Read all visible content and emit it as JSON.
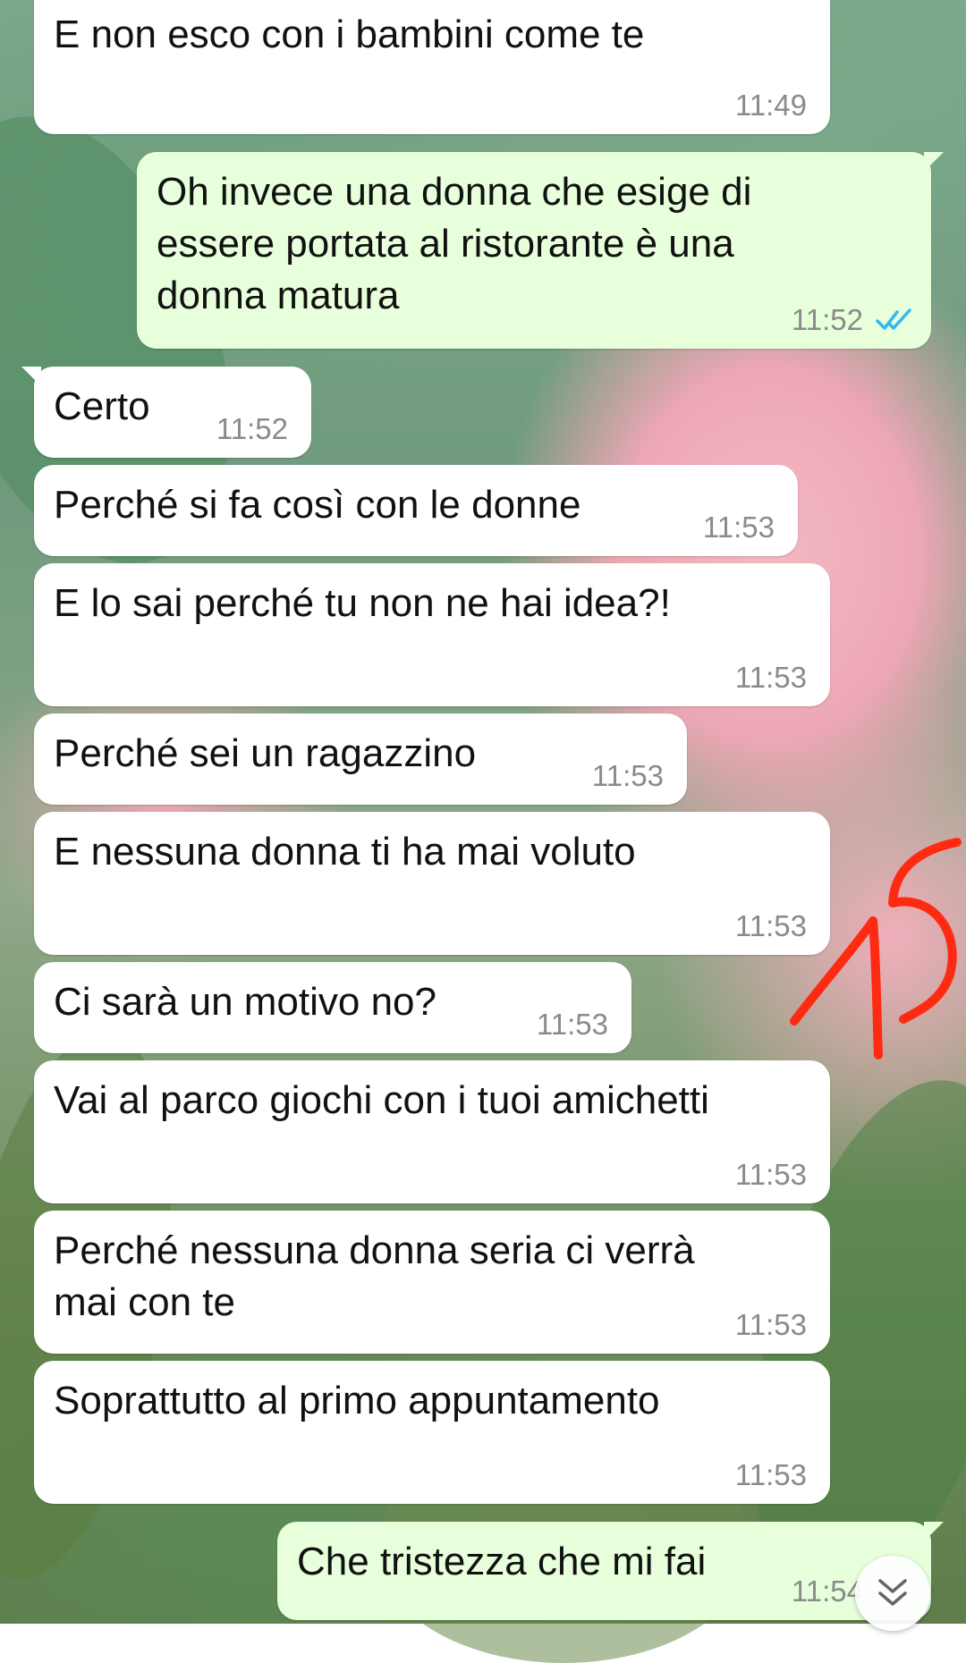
{
  "messages": [
    {
      "id": "m1",
      "direction": "incoming",
      "text": "E non esco con i bambini come te",
      "time": "11:49"
    },
    {
      "id": "m2",
      "direction": "outgoing",
      "text": "Oh invece una donna che esige di\nessere portata al ristorante è una\ndonna matura",
      "time": "11:52",
      "status": "read"
    },
    {
      "id": "m3",
      "direction": "incoming",
      "text": "Certo",
      "time": "11:52"
    },
    {
      "id": "m4",
      "direction": "incoming",
      "text": "Perché si fa così con le donne",
      "time": "11:53"
    },
    {
      "id": "m5",
      "direction": "incoming",
      "text": "E lo sai perché tu non ne hai idea?!",
      "time": "11:53"
    },
    {
      "id": "m6",
      "direction": "incoming",
      "text": "Perché sei un ragazzino",
      "time": "11:53"
    },
    {
      "id": "m7",
      "direction": "incoming",
      "text": "E nessuna donna ti ha mai voluto",
      "time": "11:53"
    },
    {
      "id": "m8",
      "direction": "incoming",
      "text": "Ci sarà un motivo no?",
      "time": "11:53"
    },
    {
      "id": "m9",
      "direction": "incoming",
      "text": "Vai al parco giochi con i tuoi amichetti",
      "time": "11:53"
    },
    {
      "id": "m10",
      "direction": "incoming",
      "text": "Perché nessuna donna seria ci verrà\nmai con te",
      "time": "11:53"
    },
    {
      "id": "m11",
      "direction": "incoming",
      "text": "Soprattutto al primo appuntamento",
      "time": "11:53"
    },
    {
      "id": "m12",
      "direction": "outgoing",
      "text": "Che tristezza che mi fai",
      "time": "11:54"
    }
  ],
  "annotation": {
    "text": "15",
    "color": "#ff2a12"
  },
  "colors": {
    "incoming_bubble": "#ffffff",
    "outgoing_bubble": "#e7ffdb",
    "read_ticks": "#34b7f1",
    "timestamp": "#8a8a8a"
  },
  "icons": {
    "read_status": "double-check-icon",
    "scroll_down": "double-chevron-down-icon"
  }
}
